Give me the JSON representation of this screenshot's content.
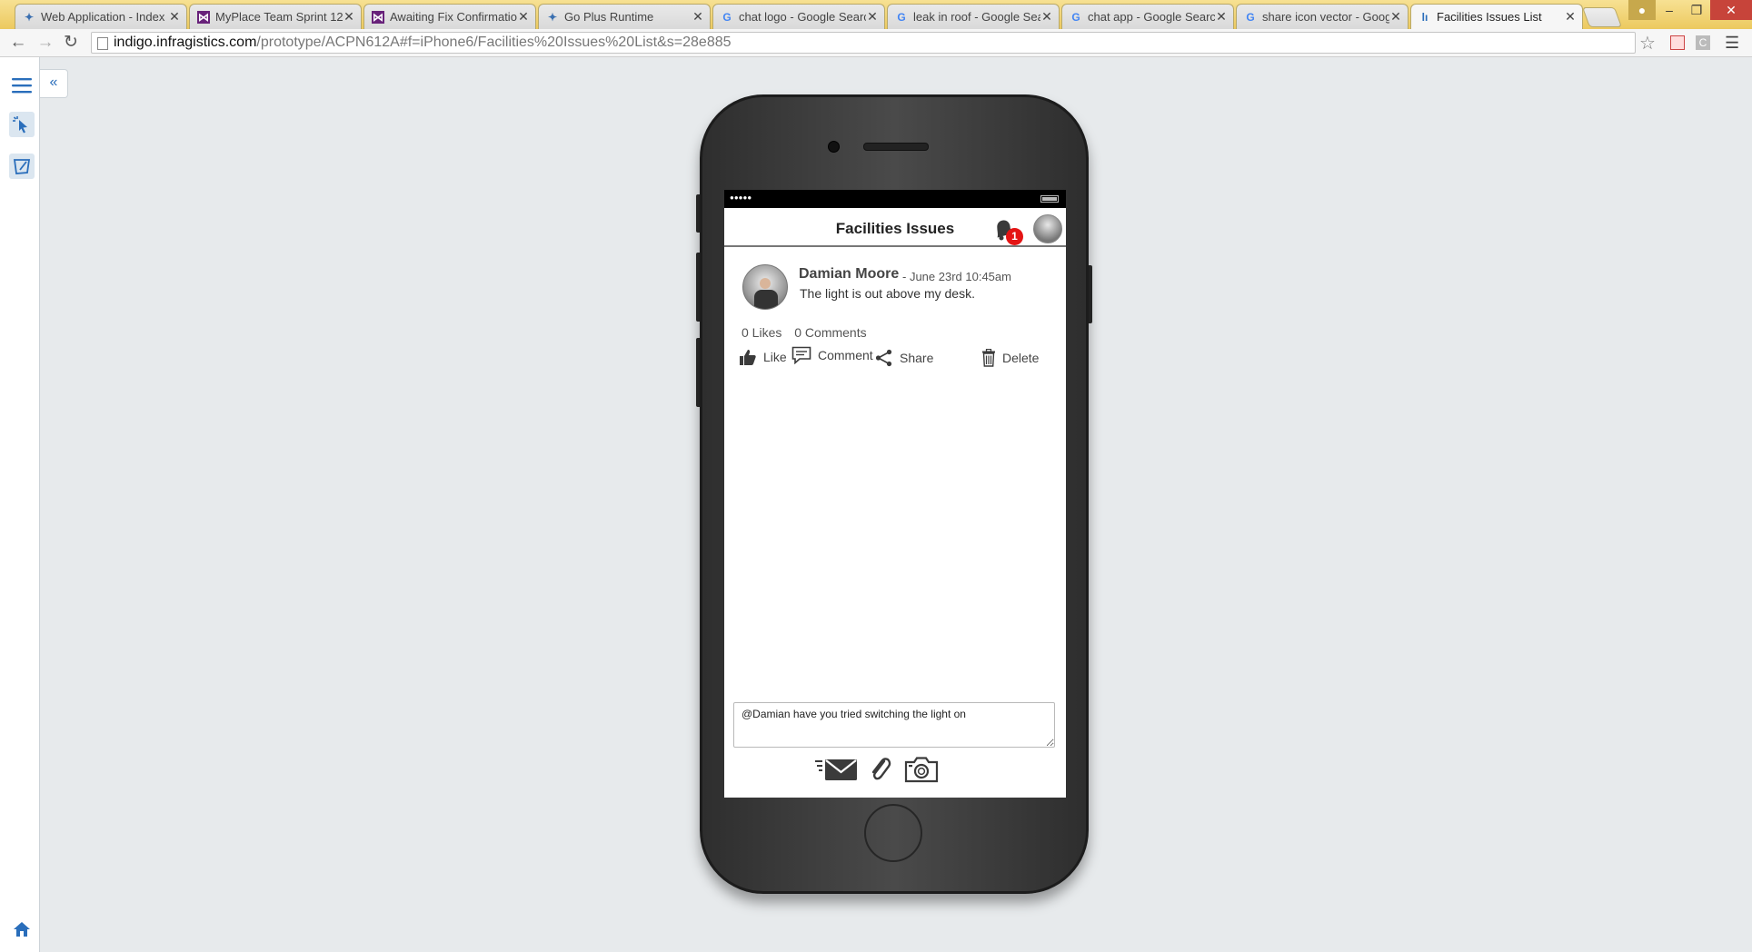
{
  "browser": {
    "tabs": [
      {
        "title": "Web Application - Index",
        "favicon": "gear-icon",
        "active": false
      },
      {
        "title": "MyPlace Team Sprint 12 -",
        "favicon": "vs-icon",
        "active": false
      },
      {
        "title": "Awaiting Fix Confirmation",
        "favicon": "vs-icon",
        "active": false
      },
      {
        "title": "Go Plus Runtime",
        "favicon": "gear-icon",
        "active": false
      },
      {
        "title": "chat logo - Google Search",
        "favicon": "google-icon",
        "active": false
      },
      {
        "title": "leak in roof - Google Sear",
        "favicon": "google-icon",
        "active": false
      },
      {
        "title": "chat app - Google Search",
        "favicon": "google-icon",
        "active": false
      },
      {
        "title": "share icon vector - Googl",
        "favicon": "google-icon",
        "active": false
      },
      {
        "title": "Facilities Issues List",
        "favicon": "indigo-icon",
        "active": true
      }
    ],
    "url_host": "indigo.infragistics.com",
    "url_path": "/prototype/ACPN612A#f=iPhone6/Facilities%20Issues%20List&s=28e885"
  },
  "app": {
    "title": "Facilities Issues",
    "notification_count": "1",
    "post": {
      "author": "Damian Moore",
      "date": "- June 23rd 10:45am",
      "message": "The light is out above my desk.",
      "likes": "0 Likes",
      "comments": "0 Comments"
    },
    "actions": {
      "like": "Like",
      "comment": "Comment",
      "share": "Share",
      "delete": "Delete"
    },
    "composer_text": "@Damian have you tried switching the light on"
  },
  "colors": {
    "tab_strip": "#f0d36e",
    "canvas": "#e7eaec",
    "rail_accent": "#2a6ebb",
    "badge": "#e41414"
  }
}
